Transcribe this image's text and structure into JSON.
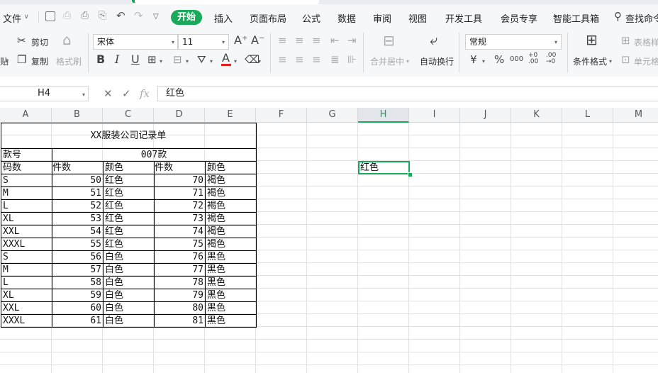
{
  "menu": {
    "file": "文件",
    "tabs": [
      "开始",
      "插入",
      "页面布局",
      "公式",
      "数据",
      "审阅",
      "视图",
      "开发工具",
      "会员专享",
      "智能工具箱"
    ],
    "active_tab": "开始",
    "search": "查找命令"
  },
  "ribbon": {
    "cut": "剪切",
    "copy": "复制",
    "format_painter": "格式刷",
    "paste_partial": "贴",
    "font_name": "宋体",
    "font_size": "11",
    "merge_center": "合并居中",
    "wrap_text": "自动换行",
    "number_format": "常规",
    "conditional_format": "条件格式",
    "table_style": "表格样",
    "cell_style": "单元格"
  },
  "formula_bar": {
    "name_box": "H4",
    "formula": "红色"
  },
  "columns": [
    "A",
    "B",
    "C",
    "D",
    "E",
    "F",
    "G",
    "H",
    "I",
    "J",
    "K",
    "L",
    "M"
  ],
  "selected_column": "H",
  "sheet": {
    "title": "XX服装公司记录单",
    "style_label": "款号",
    "style_value": "007款",
    "headers": [
      "码数",
      "件数",
      "颜色",
      "件数",
      "颜色"
    ],
    "rows": [
      [
        "S",
        "50",
        "红色",
        "70",
        "褐色"
      ],
      [
        "M",
        "51",
        "红色",
        "71",
        "褐色"
      ],
      [
        "L",
        "52",
        "红色",
        "72",
        "褐色"
      ],
      [
        "XL",
        "53",
        "红色",
        "73",
        "褐色"
      ],
      [
        "XXL",
        "54",
        "红色",
        "74",
        "褐色"
      ],
      [
        "XXXL",
        "55",
        "红色",
        "75",
        "褐色"
      ],
      [
        "S",
        "56",
        "白色",
        "76",
        "黑色"
      ],
      [
        "M",
        "57",
        "白色",
        "77",
        "黑色"
      ],
      [
        "L",
        "58",
        "白色",
        "78",
        "黑色"
      ],
      [
        "XL",
        "59",
        "白色",
        "79",
        "黑色"
      ],
      [
        "XXL",
        "60",
        "白色",
        "80",
        "黑色"
      ],
      [
        "XXXL",
        "61",
        "白色",
        "81",
        "黑色"
      ]
    ],
    "active_cell_value": "红色"
  },
  "colors": {
    "accent": "#1aa85a",
    "font_color_swatch": "#e02020"
  }
}
